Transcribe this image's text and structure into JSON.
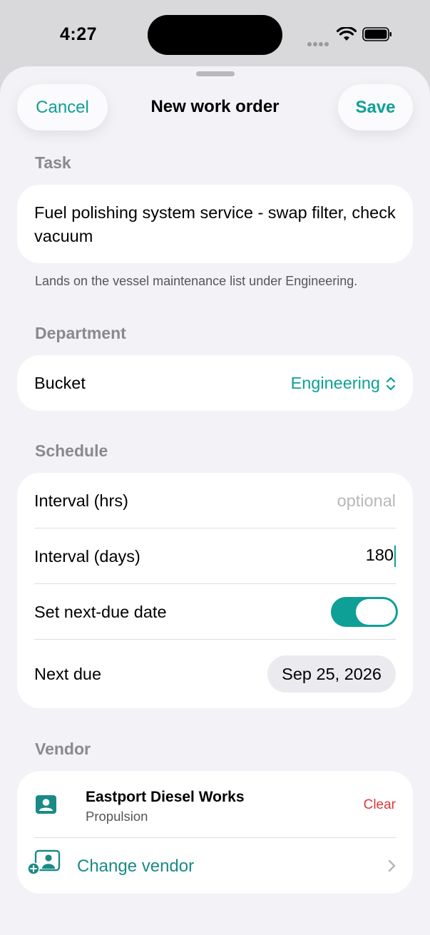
{
  "status_bar": {
    "time": "4:27"
  },
  "header": {
    "cancel_label": "Cancel",
    "title": "New work order",
    "save_label": "Save"
  },
  "task": {
    "section_label": "Task",
    "value": "Fuel polishing system service - swap filter, check vacuum",
    "footnote": "Lands on the vessel maintenance list under Engineering."
  },
  "department": {
    "section_label": "Department",
    "bucket_label": "Bucket",
    "bucket_value": "Engineering"
  },
  "schedule": {
    "section_label": "Schedule",
    "interval_hrs_label": "Interval (hrs)",
    "interval_hrs_placeholder": "optional",
    "interval_days_label": "Interval (days)",
    "interval_days_value": "180",
    "next_due_toggle_label": "Set next-due date",
    "next_due_toggle_on": true,
    "next_due_label": "Next due",
    "next_due_value": "Sep 25, 2026"
  },
  "vendor": {
    "section_label": "Vendor",
    "name": "Eastport Diesel Works",
    "category": "Propulsion",
    "clear_label": "Clear",
    "change_label": "Change vendor"
  },
  "colors": {
    "accent": "#0ea096",
    "destructive": "#e0373a",
    "background": "#f2f2f7"
  }
}
